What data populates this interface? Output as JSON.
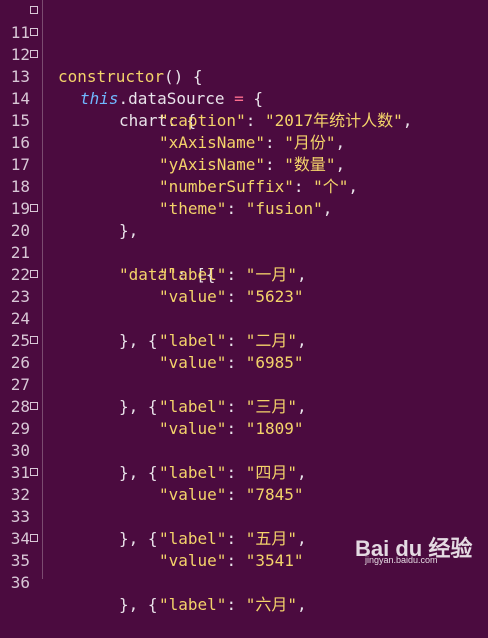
{
  "lines": [
    {
      "n": "11",
      "fold": true
    },
    {
      "n": "12",
      "fold": true
    },
    {
      "n": "13",
      "fold": true
    },
    {
      "n": "14",
      "fold": false
    },
    {
      "n": "15",
      "fold": false
    },
    {
      "n": "16",
      "fold": false
    },
    {
      "n": "17",
      "fold": false
    },
    {
      "n": "18",
      "fold": false
    },
    {
      "n": "19",
      "fold": false
    },
    {
      "n": "20",
      "fold": true
    },
    {
      "n": "21",
      "fold": false
    },
    {
      "n": "22",
      "fold": false
    },
    {
      "n": "23",
      "fold": true
    },
    {
      "n": "24",
      "fold": false
    },
    {
      "n": "25",
      "fold": false
    },
    {
      "n": "26",
      "fold": true
    },
    {
      "n": "27",
      "fold": false
    },
    {
      "n": "28",
      "fold": false
    },
    {
      "n": "29",
      "fold": true
    },
    {
      "n": "30",
      "fold": false
    },
    {
      "n": "31",
      "fold": false
    },
    {
      "n": "32",
      "fold": true
    },
    {
      "n": "33",
      "fold": false
    },
    {
      "n": "34",
      "fold": false
    },
    {
      "n": "35",
      "fold": true
    },
    {
      "n": "36",
      "fold": false
    }
  ],
  "tokens": {
    "constructor": "constructor",
    "parens_open": "() {",
    "this": "this",
    "dot_ds": ".dataSource",
    "eq": " = ",
    "brace": "{",
    "chart": "chart",
    "colon_brace": ": {",
    "caption_key": "\"caption\"",
    "caption_val": "\"2017年统计人数\"",
    "xaxis_key": "\"xAxisName\"",
    "xaxis_val": "\"月份\"",
    "yaxis_key": "\"yAxisName\"",
    "yaxis_val": "\"数量\"",
    "suffix_key": "\"numberSuffix\"",
    "suffix_val": "\"个\"",
    "theme_key": "\"theme\"",
    "theme_val": "\"fusion\"",
    "close_chart": "},",
    "data_key": "\"data\"",
    "data_open": ": [{",
    "label_key": "\"label\"",
    "value_key": "\"value\"",
    "sep_colon": ": ",
    "comma": ",",
    "item_sep": "}, {",
    "items": [
      {
        "label": "\"一月\"",
        "value": "\"5623\""
      },
      {
        "label": "\"二月\"",
        "value": "\"6985\""
      },
      {
        "label": "\"三月\"",
        "value": "\"1809\""
      },
      {
        "label": "\"四月\"",
        "value": "\"7845\""
      },
      {
        "label": "\"五月\"",
        "value": "\"3541\""
      },
      {
        "label": "\"六月\""
      }
    ]
  },
  "watermark": {
    "brand": "Bai du 经验",
    "url": "jingyan.baidu.com"
  }
}
